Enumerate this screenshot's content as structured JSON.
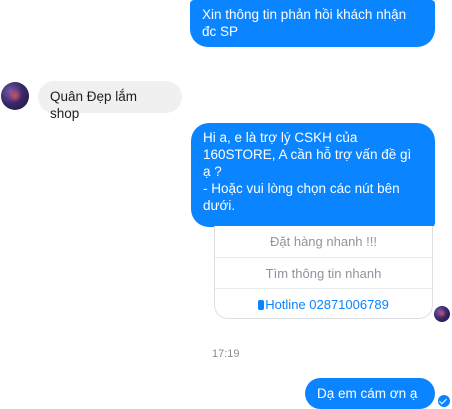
{
  "messages": {
    "m1": "Xin thông tin phản hồi khách nhận đc SP",
    "m2": "Quân Đẹp lắm shop",
    "m3_l1": "Hi a, e là trợ lý CSKH của",
    "m3_l2": "160STORE, A cần hỗ trợ vấn đề gì",
    "m3_l3": "ạ ?",
    "m3_l4": "- Hoặc vui lòng chọn các nút bên",
    "m3_l5": "dưới.",
    "m4": "Dạ em cám ơn ạ"
  },
  "quick_replies": {
    "order": "Đặt hàng nhanh !!!",
    "info": "Tìm thông tin nhanh",
    "hotline": "Hotline 02871006789"
  },
  "timestamp": "17:19",
  "icons": {
    "phone": "phone-icon",
    "read_receipt": "check-circle-icon"
  },
  "colors": {
    "outgoing_bubble": "#0a84ff",
    "incoming_bubble": "#f1f0f0"
  }
}
